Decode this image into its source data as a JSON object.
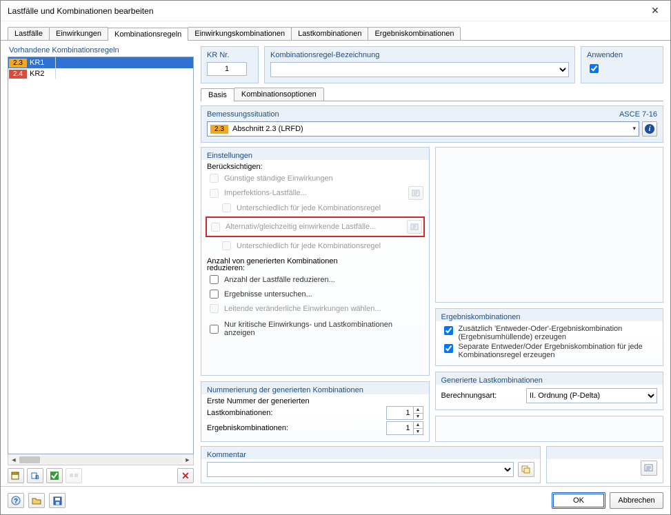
{
  "window": {
    "title": "Lastfälle und Kombinationen bearbeiten"
  },
  "tabs": [
    "Lastfälle",
    "Einwirkungen",
    "Kombinationsregeln",
    "Einwirkungskombinationen",
    "Lastkombinationen",
    "Ergebniskombinationen"
  ],
  "activeTab": 2,
  "left": {
    "title": "Vorhandene Kombinationsregeln",
    "rules": [
      {
        "badge": "2.3",
        "badgeClass": "badge-orange",
        "name": "KR1",
        "selected": true
      },
      {
        "badge": "2.4",
        "badgeClass": "badge-red",
        "name": "KR2",
        "selected": false
      }
    ]
  },
  "krNr": {
    "title": "KR Nr.",
    "value": "1"
  },
  "bezeichnung": {
    "title": "Kombinationsregel-Bezeichnung",
    "value": ""
  },
  "anwenden": {
    "title": "Anwenden",
    "checked": true
  },
  "subtabs": [
    "Basis",
    "Kombinationsoptionen"
  ],
  "activeSubtab": 0,
  "bemessung": {
    "title": "Bemessungssituation",
    "norm": "ASCE 7-16",
    "badge": "2.3",
    "value": "Abschnitt 2.3 (LRFD)"
  },
  "einstellungen": {
    "title": "Einstellungen",
    "sub1": "Berücksichtigen:",
    "opt_guenstig": "Günstige ständige Einwirkungen",
    "opt_imperf": "Imperfektions-Lastfälle...",
    "opt_unterschiedlich": "Unterschiedlich für jede Kombinationsregel",
    "opt_alt": "Alternativ/gleichzeitig einwirkende Lastfälle...",
    "opt_unterschiedlich2": "Unterschiedlich für jede Kombinationsregel",
    "sub2a": "Anzahl von generierten Kombinationen",
    "sub2b": "reduzieren:",
    "opt_anzahl": "Anzahl der Lastfälle reduzieren...",
    "opt_ergebnisse": "Ergebnisse untersuchen...",
    "opt_leitende": "Leitende veränderliche Einwirkungen wählen...",
    "opt_kritisch": "Nur kritische Einwirkungs- und Lastkombinationen anzeigen"
  },
  "nummerierung": {
    "title": "Nummerierung der generierten Kombinationen",
    "sub": "Erste Nummer der generierten",
    "lastk": "Lastkombinationen:",
    "lastk_val": "1",
    "ergk": "Ergebniskombinationen:",
    "ergk_val": "1"
  },
  "ergebnis": {
    "title": "Ergebniskombinationen",
    "opt1a": "Zusätzlich 'Entweder-Oder'-Ergebniskombination",
    "opt1b": "(Ergebnisumhüllende) erzeugen",
    "opt2a": "Separate Entweder/Oder Ergebniskombination für jede",
    "opt2b": "Kombinationsregel  erzeugen"
  },
  "genLastk": {
    "title": "Generierte Lastkombinationen",
    "label": "Berechnungsart:",
    "value": "II. Ordnung (P-Delta)"
  },
  "kommentar": {
    "title": "Kommentar",
    "value": ""
  },
  "footer": {
    "ok": "OK",
    "cancel": "Abbrechen"
  }
}
